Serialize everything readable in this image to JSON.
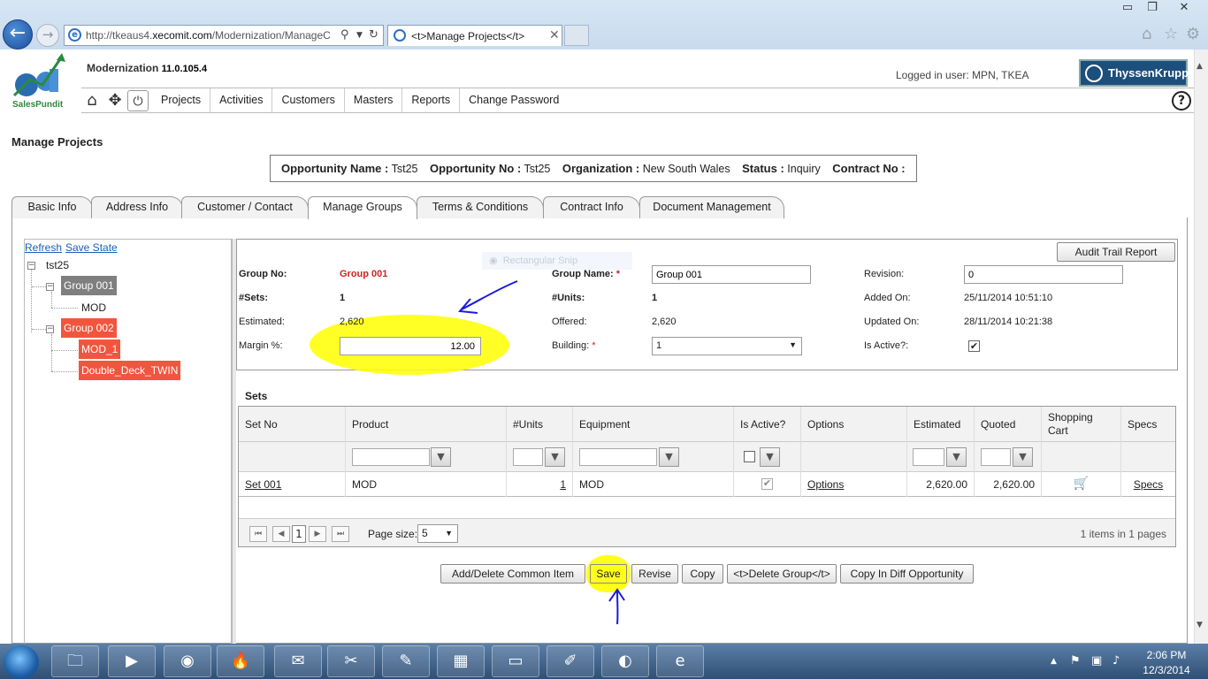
{
  "browser": {
    "url_prefix": "http://tkeaus4.",
    "url_domain": "xecomit.com",
    "url_rest": "/Modernization/ManageC",
    "tab_title": "<t>Manage Projects</t>"
  },
  "header": {
    "app_name": "Modernization",
    "app_version": "11.0.105.4",
    "logo_text": "SalesPundit",
    "logged_in": "Logged in user: MPN, TKEA",
    "brand": "ThyssenKrupp"
  },
  "menu": [
    "Projects",
    "Activities",
    "Customers",
    "Masters",
    "Reports",
    "Change Password"
  ],
  "page": {
    "title": "Manage Projects",
    "opportunity": {
      "name_label": "Opportunity Name :",
      "name": "Tst25",
      "no_label": "Opportunity No :",
      "no": "Tst25",
      "org_label": "Organization :",
      "org": "New South Wales",
      "status_label": "Status :",
      "status": "Inquiry",
      "contract_label": "Contract No :"
    },
    "tabs": [
      "Basic Info",
      "Address Info",
      "Customer / Contact",
      "Manage Groups",
      "Terms & Conditions",
      "Contract Info",
      "Document Management"
    ],
    "active_tab": "Manage Groups"
  },
  "tree": {
    "refresh": "Refresh",
    "save_state": "Save State",
    "root": "tst25",
    "nodes": [
      "Group 001",
      "MOD",
      "Group 002",
      "MOD_1",
      "Double_Deck_TWIN"
    ]
  },
  "group": {
    "audit_button": "Audit Trail Report",
    "group_no_label": "Group No:",
    "group_no": "Group 001",
    "group_name_label": "Group Name:",
    "group_name": "Group 001",
    "revision_label": "Revision:",
    "revision": "0",
    "sets_label": "#Sets:",
    "sets": "1",
    "units_label": "#Units:",
    "units": "1",
    "added_label": "Added On:",
    "added": "25/11/2014 10:51:10",
    "estimated_label": "Estimated:",
    "estimated": "2,620",
    "offered_label": "Offered:",
    "offered": "2,620",
    "updated_label": "Updated On:",
    "updated": "28/11/2014 10:21:38",
    "margin_label": "Margin %:",
    "margin": "12.00",
    "building_label": "Building:",
    "building": "1",
    "active_label": "Is Active?:",
    "is_active": true
  },
  "sets": {
    "title": "Sets",
    "headers": [
      "Set No",
      "Product",
      "#Units",
      "Equipment",
      "Is Active?",
      "Options",
      "Estimated",
      "Quoted",
      "Shopping Cart",
      "Specs"
    ],
    "rows": [
      {
        "set_no": "Set 001",
        "product": "MOD",
        "units": "1",
        "equipment": "MOD",
        "is_active": true,
        "options": "Options",
        "estimated": "2,620.00",
        "quoted": "2,620.00",
        "specs": "Specs"
      }
    ],
    "page": "1",
    "page_size_label": "Page size:",
    "page_size": "5",
    "pager_info": "1 items in 1 pages"
  },
  "actions": [
    "Add/Delete Common Item",
    "Save",
    "Revise",
    "Copy",
    "<t>Delete Group</t>",
    "Copy In Diff Opportunity"
  ],
  "overlay": {
    "snip_hint": "Rectangular Snip",
    "highlight_color": "#ffff00",
    "annotation_color": "#1a1adf"
  },
  "taskbar": {
    "time": "2:06 PM",
    "date": "12/3/2014"
  }
}
